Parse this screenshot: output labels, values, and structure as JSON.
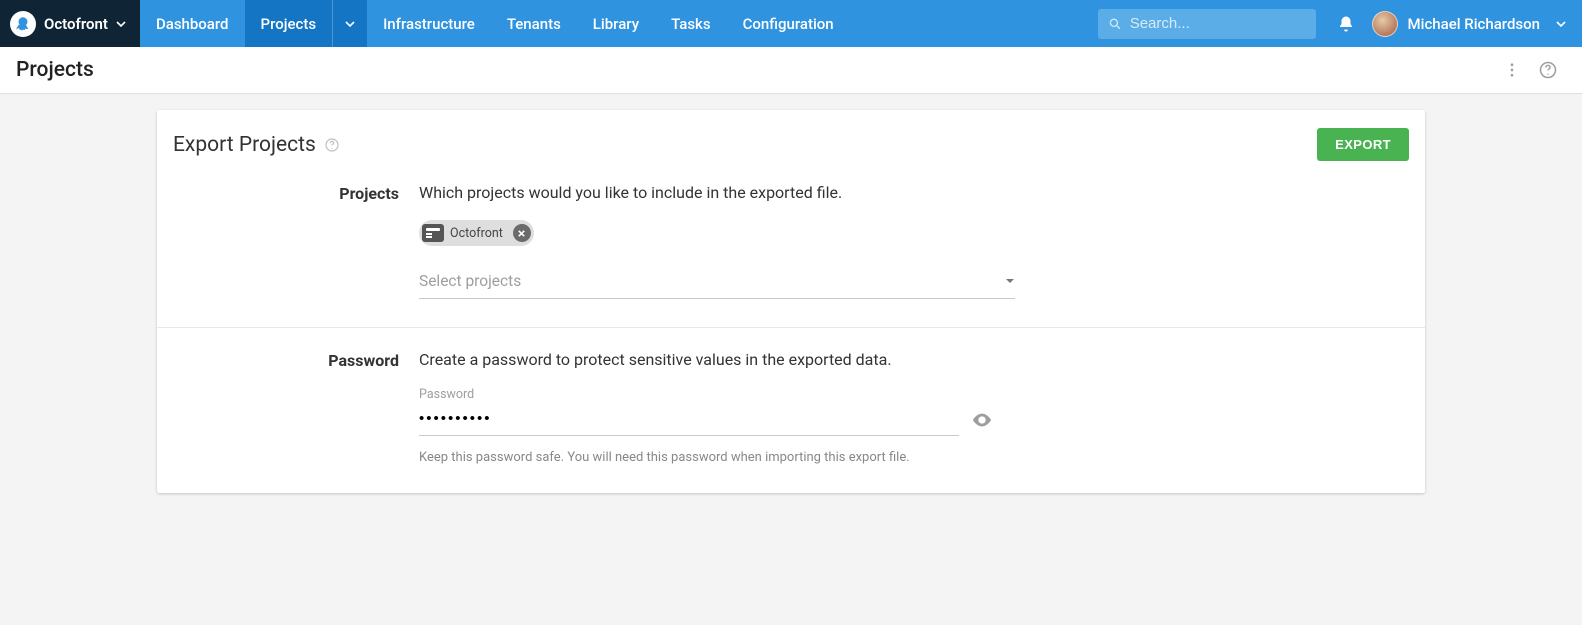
{
  "brand": {
    "name": "Octofront"
  },
  "nav": {
    "items": [
      {
        "label": "Dashboard"
      },
      {
        "label": "Projects"
      },
      {
        "label": "Infrastructure"
      },
      {
        "label": "Tenants"
      },
      {
        "label": "Library"
      },
      {
        "label": "Tasks"
      },
      {
        "label": "Configuration"
      }
    ]
  },
  "search": {
    "placeholder": "Search..."
  },
  "user": {
    "name": "Michael Richardson"
  },
  "page": {
    "title": "Projects"
  },
  "export": {
    "title": "Export Projects",
    "button": "EXPORT",
    "projects": {
      "label": "Projects",
      "description": "Which projects would you like to include in the exported file.",
      "chips": [
        {
          "name": "Octofront"
        }
      ],
      "select_placeholder": "Select projects"
    },
    "password": {
      "label": "Password",
      "description": "Create a password to protect sensitive values in the exported data.",
      "field_label": "Password",
      "value": "••••••••••",
      "helper": "Keep this password safe. You will need this password when importing this export file."
    }
  }
}
